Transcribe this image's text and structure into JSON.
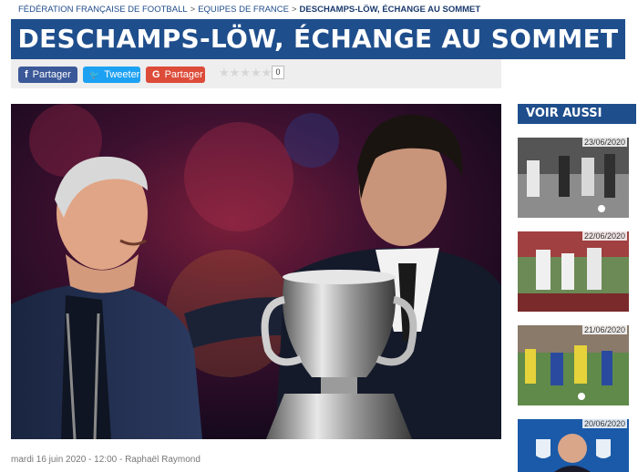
{
  "breadcrumb": {
    "items": [
      "FÉDÉRATION FRANÇAISE DE FOOTBALL",
      "EQUIPES DE FRANCE"
    ],
    "current": "DESCHAMPS-LÖW, ÉCHANGE AU SOMMET",
    "separator": ">"
  },
  "article": {
    "title": "DESCHAMPS-LÖW, ÉCHANGE AU SOMMET",
    "meta": "mardi 16 juin 2020 - 12:00 - Raphaël Raymond"
  },
  "share": {
    "facebook_label": "Partager",
    "facebook_icon": "f",
    "twitter_label": "Tweeter",
    "twitter_icon": "🐦",
    "google_label": "Partager",
    "google_icon": "G",
    "rating_stars": "★★★★★",
    "rating_count": "0"
  },
  "aside": {
    "title": "VOIR AUSSI",
    "items": [
      {
        "date": "23/06/2020"
      },
      {
        "date": "22/06/2020"
      },
      {
        "date": "21/06/2020"
      },
      {
        "date": "20/06/2020"
      }
    ]
  },
  "colors": {
    "brand": "#1f4e8c",
    "facebook": "#3b5998",
    "twitter": "#1da1f2",
    "google": "#dd4b39"
  }
}
